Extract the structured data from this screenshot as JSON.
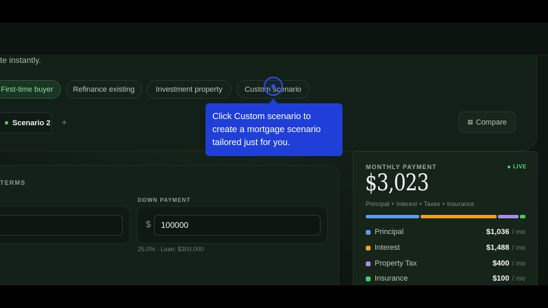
{
  "hero": {
    "subtitle": "te instantly."
  },
  "chips": [
    {
      "label": "First-time buyer",
      "active": true
    },
    {
      "label": "Refinance existing",
      "active": false
    },
    {
      "label": "Investment property",
      "active": false
    },
    {
      "label": "Custom scenario",
      "active": false
    }
  ],
  "tabs": {
    "active_label": "Scenario 2",
    "add_icon": "+",
    "compare_label": "Compare",
    "compare_icon": "compare-icon"
  },
  "tooltip": {
    "text": "Click Custom scenario to create a mortgage scenario tailored just for you."
  },
  "terms": {
    "label": "TERMS",
    "down_payment_label": "DOWN PAYMENT",
    "currency_symbol": "$",
    "down_payment_value": "100000",
    "down_payment_note": "25.0% · Loan: $300,000"
  },
  "payment": {
    "label": "MONTHLY PAYMENT",
    "live_label": "LIVE",
    "amount": "$3,023",
    "note": "Principal + Interest + Taxes + Insurance",
    "unit": "/ mo",
    "breakdown": [
      {
        "name": "Principal",
        "value": "$1,036",
        "amount": 1036,
        "color": "#5b9cf0"
      },
      {
        "name": "Interest",
        "value": "$1,488",
        "amount": 1488,
        "color": "#f0a21c"
      },
      {
        "name": "Property Tax",
        "value": "$400",
        "amount": 400,
        "color": "#a98bf0"
      },
      {
        "name": "Insurance",
        "value": "$100",
        "amount": 100,
        "color": "#3ed06c"
      }
    ]
  }
}
